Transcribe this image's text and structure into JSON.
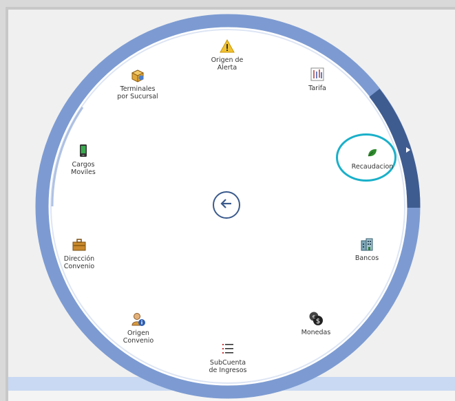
{
  "menu": {
    "items": [
      {
        "key": "origen-alerta",
        "label_line1": "Origen de",
        "label_line2": "Alerta",
        "icon": "warning-icon"
      },
      {
        "key": "tarifa",
        "label_line1": "Tarifa",
        "label_line2": "",
        "icon": "tariff-chart-icon"
      },
      {
        "key": "recaudacion",
        "label_line1": "Recaudacion",
        "label_line2": "",
        "icon": "leaf-icon"
      },
      {
        "key": "bancos",
        "label_line1": "Bancos",
        "label_line2": "",
        "icon": "bank-building-icon"
      },
      {
        "key": "monedas",
        "label_line1": "Monedas",
        "label_line2": "",
        "icon": "coins-icon"
      },
      {
        "key": "subcuenta",
        "label_line1": "SubCuenta",
        "label_line2": "de Ingresos",
        "icon": "list-icon"
      },
      {
        "key": "origen-convenio",
        "label_line1": "Origen",
        "label_line2": "Convenio",
        "icon": "user-info-icon"
      },
      {
        "key": "direccion-convenio",
        "label_line1": "Dirección",
        "label_line2": "Convenio",
        "icon": "briefcase-icon"
      },
      {
        "key": "cargos-moviles",
        "label_line1": "Cargos",
        "label_line2": "Moviles",
        "icon": "mobile-phone-icon"
      },
      {
        "key": "terminales",
        "label_line1": "Terminales",
        "label_line2": "por Sucursal",
        "icon": "terminal-box-icon"
      }
    ],
    "highlighted_item": "Recaudacion",
    "back_button": "back-arrow-icon",
    "colors": {
      "ring": "#7d9bd2",
      "ring_dark": "#3f5c90",
      "highlight": "#1ab0c9",
      "back": "#3a5a8c"
    }
  }
}
